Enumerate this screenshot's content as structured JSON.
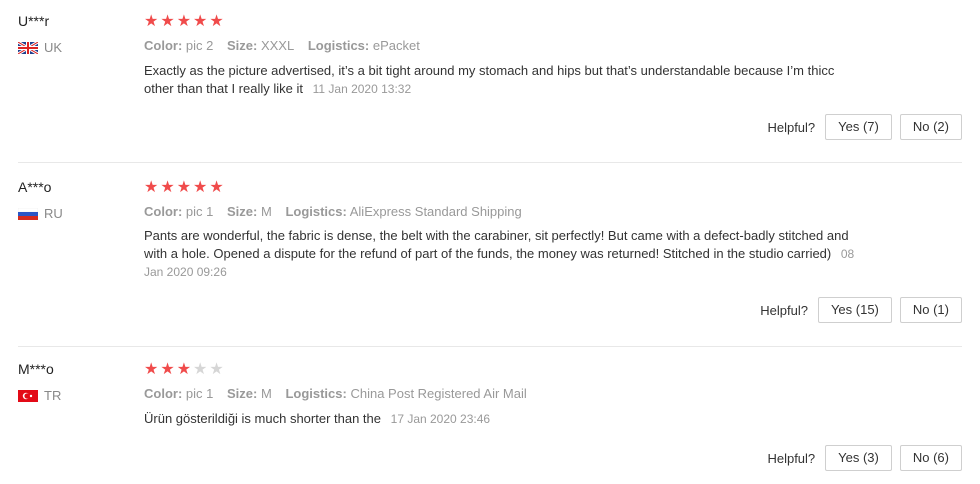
{
  "labels": {
    "color": "Color:",
    "size": "Size:",
    "logistics": "Logistics:",
    "helpful": "Helpful?"
  },
  "reviews": [
    {
      "user": "U***r",
      "country": "UK",
      "flag_icon": "uk-flag-icon",
      "rating": 5,
      "color": "pic 2",
      "size": "XXXL",
      "logistics": "ePacket",
      "text": "Exactly as the picture advertised, it’s a bit tight around my stomach and hips but that’s understandable because I’m thicc other than that I really like it",
      "date": "11 Jan 2020 13:32",
      "yes": "Yes (7)",
      "no": "No (2)"
    },
    {
      "user": "A***o",
      "country": "RU",
      "flag_icon": "russia-flag-icon",
      "rating": 5,
      "color": "pic 1",
      "size": "M",
      "logistics": "AliExpress Standard Shipping",
      "text": "Pants are wonderful, the fabric is dense, the belt with the carabiner, sit perfectly! But came with a defect-badly stitched and with a hole. Opened a dispute for the refund of part of the funds, the money was returned! Stitched in the studio carried)",
      "date": "08 Jan 2020 09:26",
      "yes": "Yes (15)",
      "no": "No (1)"
    },
    {
      "user": "M***o",
      "country": "TR",
      "flag_icon": "turkey-flag-icon",
      "rating": 3,
      "color": "pic 1",
      "size": "M",
      "logistics": "China Post Registered Air Mail",
      "text": "Ürün gösterildiği is much shorter than the",
      "date": "17 Jan 2020 23:46",
      "yes": "Yes (3)",
      "no": "No (6)"
    }
  ],
  "colors": {
    "star_on": "#f04b4b",
    "star_off": "#d6d6d6"
  }
}
